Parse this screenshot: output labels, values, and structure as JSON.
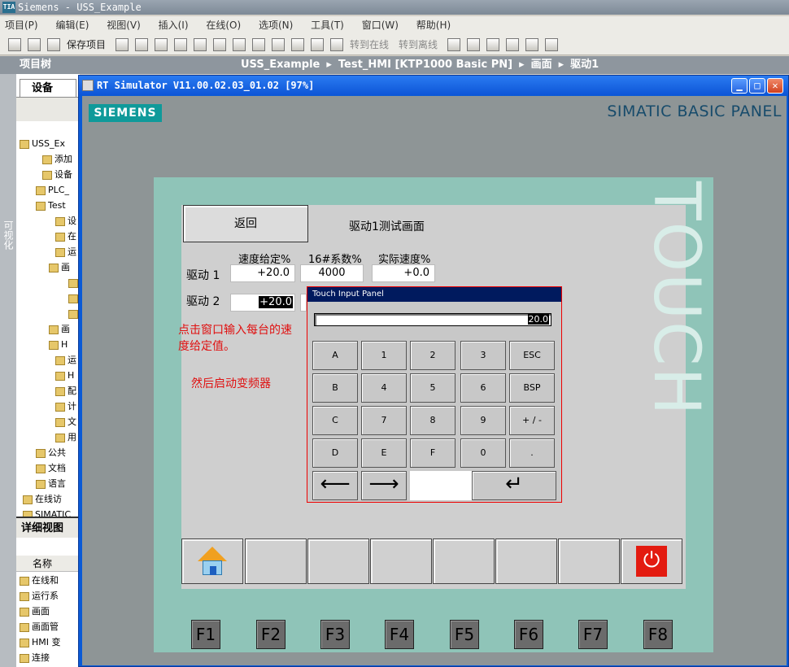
{
  "app": {
    "logo": "TIA",
    "title": "Siemens  -  USS_Example"
  },
  "menu": [
    "项目(P)",
    "编辑(E)",
    "视图(V)",
    "插入(I)",
    "在线(O)",
    "选项(N)",
    "工具(T)",
    "窗口(W)",
    "帮助(H)"
  ],
  "toolbar": {
    "save_project": "保存项目",
    "go_online": "转到在线",
    "go_offline": "转到离线"
  },
  "project_tree": {
    "title": "项目树",
    "devices_tab": "设备",
    "items": [
      "USS_Ex",
      "添加",
      "设备",
      "PLC_",
      "Test",
      "设",
      "在",
      "运",
      "画",
      "",
      "",
      "",
      "画",
      "H",
      "运",
      "H",
      "配",
      "计",
      "文",
      "用",
      "公共",
      "文档",
      "语言",
      "在线访",
      "SIMATIC"
    ],
    "detail_view_title": "详细视图",
    "detail_column_name": "名称",
    "detail_items": [
      "在线和",
      "运行系",
      "画面",
      "画面管",
      "HMI 变",
      "连接"
    ]
  },
  "left_strip_label": "可视化",
  "breadcrumb": [
    "USS_Example",
    "Test_HMI [KTP1000 Basic PN]",
    "画面",
    "驱动1"
  ],
  "simulator": {
    "title": "RT Simulator V11.00.02.03_01.02 [97%]",
    "brand": "SIEMENS",
    "panel_name": "SIMATIC BASIC PANEL",
    "touch_label": "TOUCH"
  },
  "screen": {
    "back_button": "返回",
    "title": "驱动1测试画面",
    "columns": [
      "速度给定%",
      "16#系数%",
      "实际速度%"
    ],
    "rows": [
      {
        "label": "驱动 1",
        "setpoint": "+20.0",
        "coef": "4000",
        "actual": "+0.0"
      },
      {
        "label": "驱动 2",
        "setpoint": "+20.0"
      }
    ],
    "note1": "点击窗口输入每台的速度给定值。",
    "note2": "然后启动变频器"
  },
  "touch_input_panel": {
    "title": "Touch Input Panel",
    "display": "20.0",
    "keys": [
      [
        "A",
        "1",
        "2",
        "3",
        "ESC"
      ],
      [
        "B",
        "4",
        "5",
        "6",
        "BSP"
      ],
      [
        "C",
        "7",
        "8",
        "9",
        "+ / -"
      ],
      [
        "D",
        "E",
        "F",
        "0",
        "."
      ]
    ]
  },
  "function_keys": [
    "F1",
    "F2",
    "F3",
    "F4",
    "F5",
    "F6",
    "F7",
    "F8"
  ]
}
